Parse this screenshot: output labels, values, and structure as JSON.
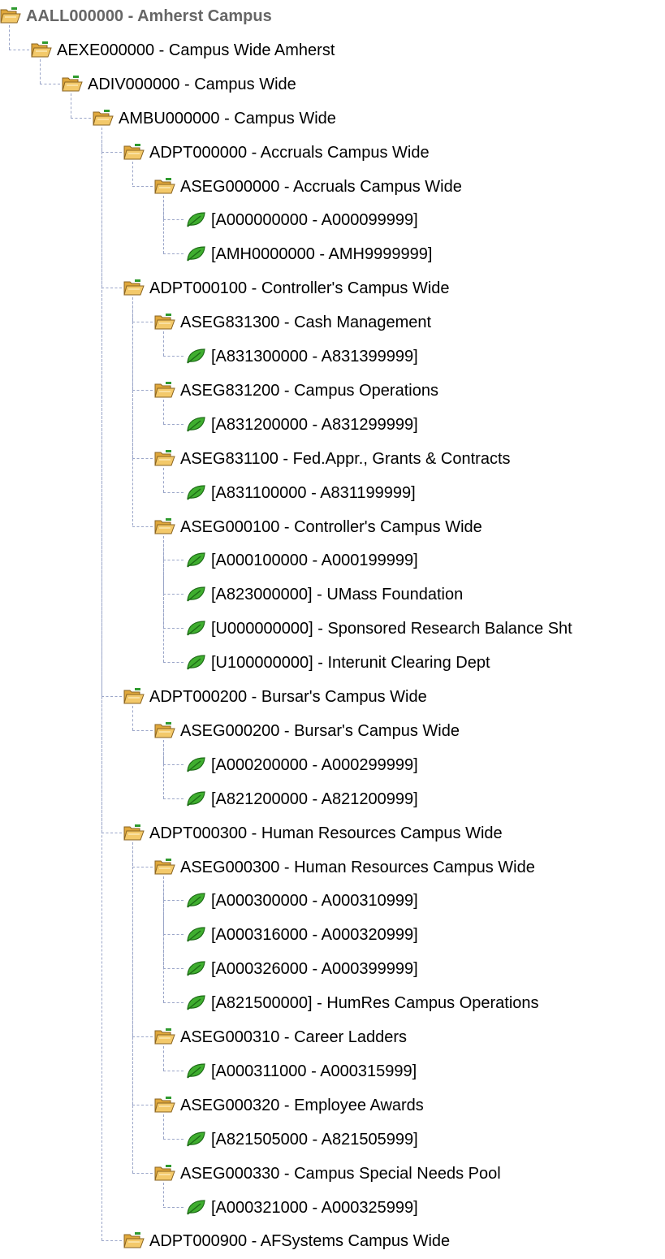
{
  "tree": {
    "nodes": [
      {
        "depth": 0,
        "type": "folder",
        "label": "AALL000000 - Amherst Campus"
      },
      {
        "depth": 1,
        "type": "folder",
        "label": "AEXE000000 - Campus Wide Amherst"
      },
      {
        "depth": 2,
        "type": "folder",
        "label": "ADIV000000 - Campus Wide"
      },
      {
        "depth": 3,
        "type": "folder",
        "label": "AMBU000000 - Campus Wide"
      },
      {
        "depth": 4,
        "type": "folder",
        "label": "ADPT000000 - Accruals Campus Wide"
      },
      {
        "depth": 5,
        "type": "folder",
        "label": "ASEG000000 - Accruals Campus Wide"
      },
      {
        "depth": 6,
        "type": "leaf",
        "label": "[A000000000 - A000099999]"
      },
      {
        "depth": 6,
        "type": "leaf",
        "label": "[AMH0000000 - AMH9999999]"
      },
      {
        "depth": 4,
        "type": "folder",
        "label": "ADPT000100 - Controller's Campus Wide"
      },
      {
        "depth": 5,
        "type": "folder",
        "label": "ASEG831300 - Cash Management"
      },
      {
        "depth": 6,
        "type": "leaf",
        "label": "[A831300000 - A831399999]"
      },
      {
        "depth": 5,
        "type": "folder",
        "label": "ASEG831200 - Campus Operations"
      },
      {
        "depth": 6,
        "type": "leaf",
        "label": "[A831200000 - A831299999]"
      },
      {
        "depth": 5,
        "type": "folder",
        "label": "ASEG831100 - Fed.Appr., Grants & Contracts"
      },
      {
        "depth": 6,
        "type": "leaf",
        "label": "[A831100000 - A831199999]"
      },
      {
        "depth": 5,
        "type": "folder",
        "label": "ASEG000100 - Controller's Campus Wide"
      },
      {
        "depth": 6,
        "type": "leaf",
        "label": "[A000100000 - A000199999]"
      },
      {
        "depth": 6,
        "type": "leaf",
        "label": "[A823000000] - UMass Foundation"
      },
      {
        "depth": 6,
        "type": "leaf",
        "label": "[U000000000] - Sponsored Research Balance Sht"
      },
      {
        "depth": 6,
        "type": "leaf",
        "label": "[U100000000] - Interunit Clearing Dept"
      },
      {
        "depth": 4,
        "type": "folder",
        "label": "ADPT000200 - Bursar's Campus Wide"
      },
      {
        "depth": 5,
        "type": "folder",
        "label": "ASEG000200 - Bursar's Campus Wide"
      },
      {
        "depth": 6,
        "type": "leaf",
        "label": "[A000200000 - A000299999]"
      },
      {
        "depth": 6,
        "type": "leaf",
        "label": "[A821200000 - A821200999]"
      },
      {
        "depth": 4,
        "type": "folder",
        "label": "ADPT000300 - Human Resources Campus Wide"
      },
      {
        "depth": 5,
        "type": "folder",
        "label": "ASEG000300 - Human Resources Campus Wide"
      },
      {
        "depth": 6,
        "type": "leaf",
        "label": "[A000300000 - A000310999]"
      },
      {
        "depth": 6,
        "type": "leaf",
        "label": "[A000316000 - A000320999]"
      },
      {
        "depth": 6,
        "type": "leaf",
        "label": "[A000326000 - A000399999]"
      },
      {
        "depth": 6,
        "type": "leaf",
        "label": "[A821500000] - HumRes Campus Operations"
      },
      {
        "depth": 5,
        "type": "folder",
        "label": "ASEG000310 - Career Ladders"
      },
      {
        "depth": 6,
        "type": "leaf",
        "label": "[A000311000 - A000315999]"
      },
      {
        "depth": 5,
        "type": "folder",
        "label": "ASEG000320 - Employee Awards"
      },
      {
        "depth": 6,
        "type": "leaf",
        "label": "[A821505000 - A821505999]"
      },
      {
        "depth": 5,
        "type": "folder",
        "label": "ASEG000330 - Campus Special Needs Pool"
      },
      {
        "depth": 6,
        "type": "leaf",
        "label": "[A000321000 - A000325999]"
      },
      {
        "depth": 4,
        "type": "folder",
        "label": "ADPT000900 - AFSystems Campus Wide"
      }
    ]
  },
  "colors": {
    "folder_body": "#f3c96a",
    "folder_tab": "#e0a83c",
    "folder_outline": "#8a6320",
    "folder_badge": "#2e9a2e",
    "leaf_fill": "#3fae2f",
    "leaf_outline": "#1d6b16",
    "tree_lines": "#9aa5c8",
    "root_text": "#666666"
  },
  "icons": {
    "folder": "open-folder-icon",
    "leaf": "leaf-icon"
  }
}
